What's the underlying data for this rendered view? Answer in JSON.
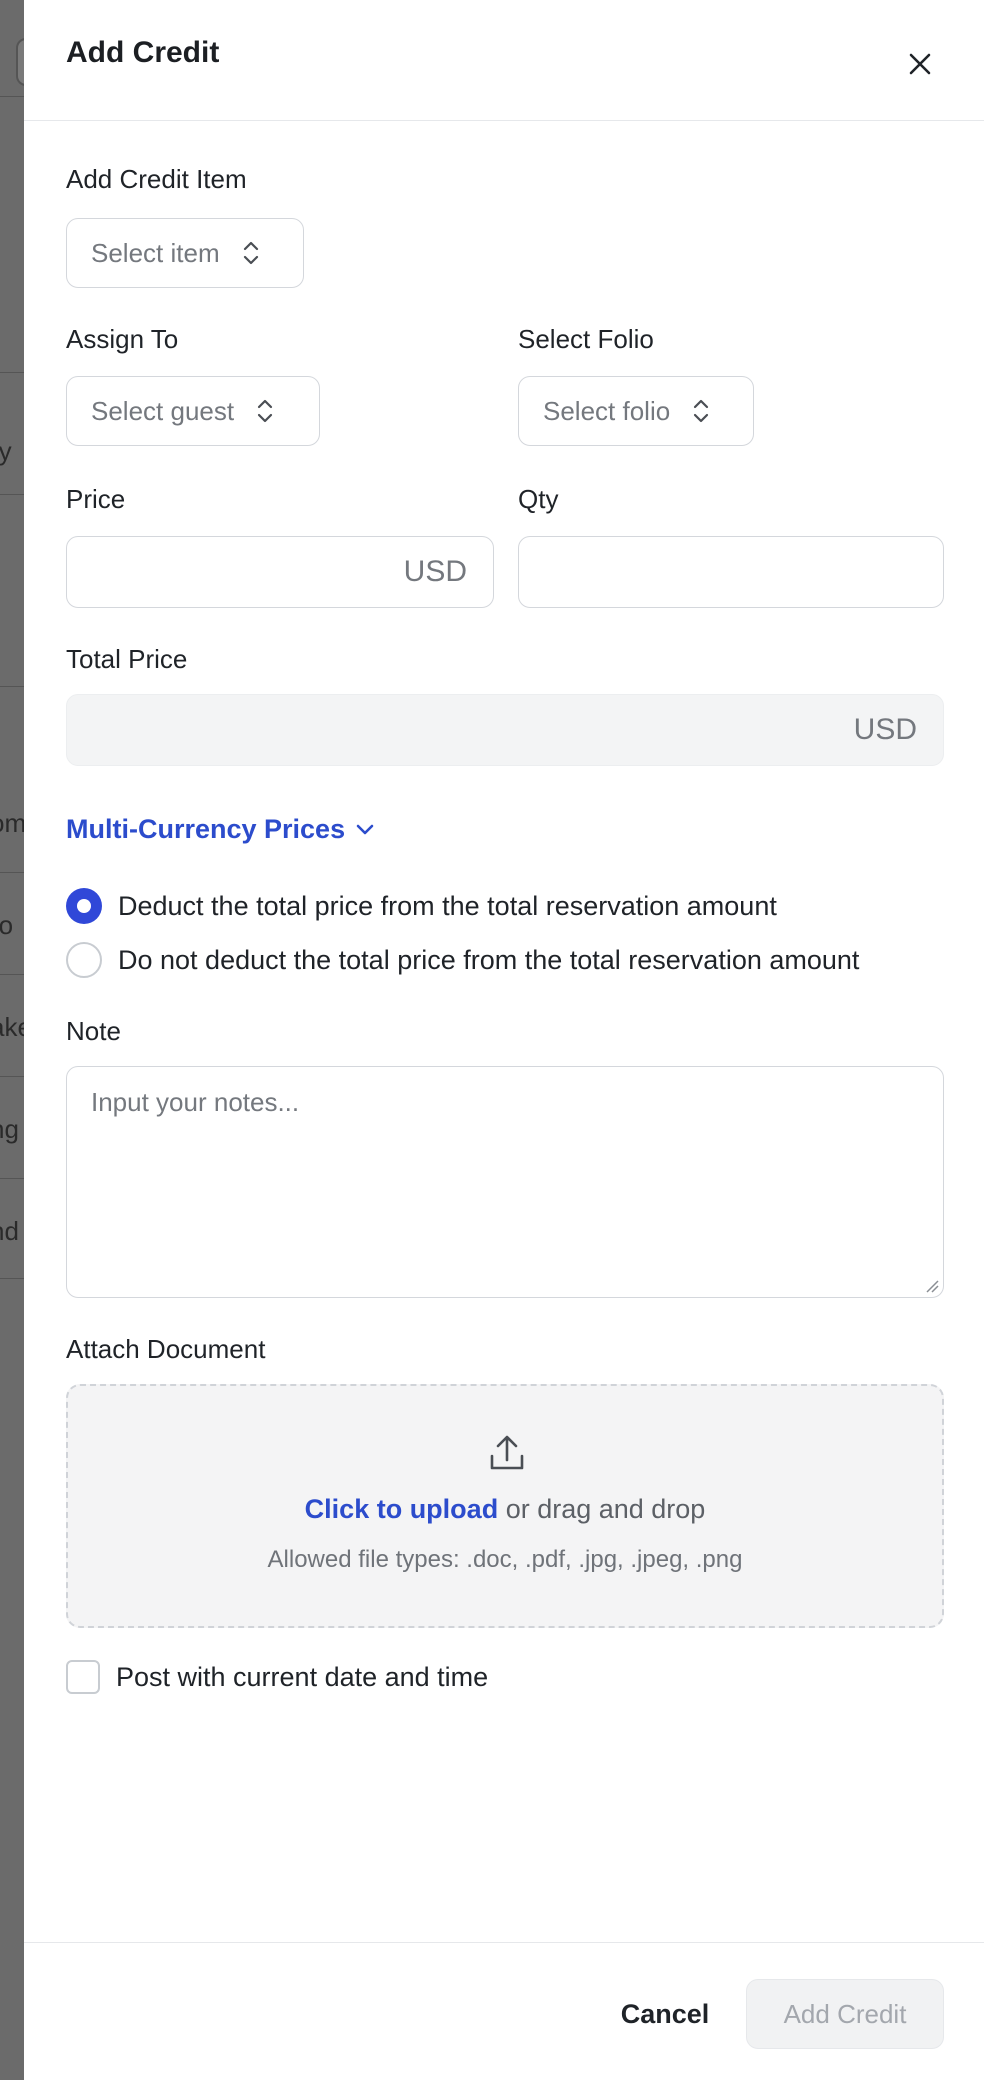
{
  "background": {
    "fragments": [
      "ry",
      "om",
      "ro",
      "ake",
      "ng",
      "nd"
    ],
    "marker": "-"
  },
  "drawer": {
    "title": "Add Credit",
    "fields": {
      "credit_item": {
        "label": "Add Credit Item",
        "placeholder": "Select item"
      },
      "assign_to": {
        "label": "Assign To",
        "placeholder": "Select guest"
      },
      "folio": {
        "label": "Select Folio",
        "placeholder": "Select folio"
      },
      "price": {
        "label": "Price",
        "currency": "USD",
        "value": ""
      },
      "qty": {
        "label": "Qty",
        "value": ""
      },
      "total_price": {
        "label": "Total Price",
        "currency": "USD",
        "value": ""
      }
    },
    "multi_currency": {
      "label": "Multi-Currency Prices",
      "icon": "chevron-down-icon"
    },
    "deduction_options": [
      {
        "label": "Deduct the total price from the total reservation amount",
        "selected": true
      },
      {
        "label": "Do not deduct the total price from the total reservation amount",
        "selected": false
      }
    ],
    "note": {
      "label": "Note",
      "placeholder": "Input your notes..."
    },
    "attachment": {
      "label": "Attach Document",
      "icon": "upload-icon",
      "upload_link": "Click to upload",
      "upload_text": " or drag and drop",
      "hint": "Allowed file types: .doc, .pdf, .jpg, .jpeg, .png"
    },
    "post_current": {
      "label": "Post with current date and time",
      "checked": false
    },
    "footer": {
      "cancel_label": "Cancel",
      "submit_label": "Add Credit"
    }
  },
  "colors": {
    "accent": "#3048d8",
    "link": "#2c4ccc",
    "overlay": "#6f6f6f"
  }
}
